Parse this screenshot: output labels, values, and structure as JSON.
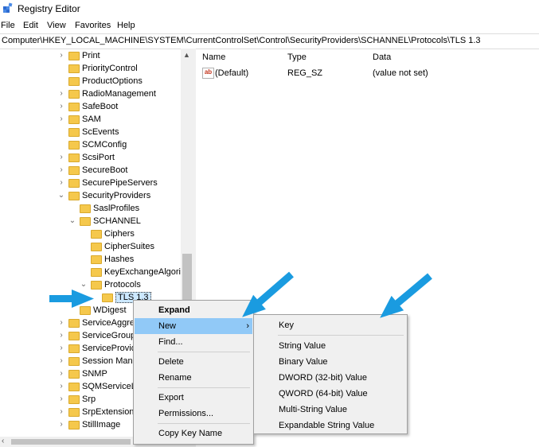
{
  "window": {
    "title": "Registry Editor"
  },
  "menu": [
    "File",
    "Edit",
    "View",
    "Favorites",
    "Help"
  ],
  "address": "Computer\\HKEY_LOCAL_MACHINE\\SYSTEM\\CurrentControlSet\\Control\\SecurityProviders\\SCHANNEL\\Protocols\\TLS 1.3",
  "tree": [
    {
      "label": "Print",
      "depth": 0,
      "exp": "›"
    },
    {
      "label": "PriorityControl",
      "depth": 0,
      "exp": ""
    },
    {
      "label": "ProductOptions",
      "depth": 0,
      "exp": ""
    },
    {
      "label": "RadioManagement",
      "depth": 0,
      "exp": "›"
    },
    {
      "label": "SafeBoot",
      "depth": 0,
      "exp": "›"
    },
    {
      "label": "SAM",
      "depth": 0,
      "exp": "›"
    },
    {
      "label": "ScEvents",
      "depth": 0,
      "exp": ""
    },
    {
      "label": "SCMConfig",
      "depth": 0,
      "exp": ""
    },
    {
      "label": "ScsiPort",
      "depth": 0,
      "exp": "›"
    },
    {
      "label": "SecureBoot",
      "depth": 0,
      "exp": "›"
    },
    {
      "label": "SecurePipeServers",
      "depth": 0,
      "exp": "›"
    },
    {
      "label": "SecurityProviders",
      "depth": 0,
      "exp": "⌄"
    },
    {
      "label": "SaslProfiles",
      "depth": 1,
      "exp": ""
    },
    {
      "label": "SCHANNEL",
      "depth": 1,
      "exp": "⌄"
    },
    {
      "label": "Ciphers",
      "depth": 2,
      "exp": ""
    },
    {
      "label": "CipherSuites",
      "depth": 2,
      "exp": ""
    },
    {
      "label": "Hashes",
      "depth": 2,
      "exp": ""
    },
    {
      "label": "KeyExchangeAlgorit",
      "depth": 2,
      "exp": ""
    },
    {
      "label": "Protocols",
      "depth": 2,
      "exp": "⌄"
    },
    {
      "label": "TLS 1.3",
      "depth": 3,
      "exp": "",
      "selected": true
    },
    {
      "label": "WDigest",
      "depth": 1,
      "exp": ""
    },
    {
      "label": "ServiceAggreg",
      "depth": 0,
      "exp": "›"
    },
    {
      "label": "ServiceGroupC",
      "depth": 0,
      "exp": "›"
    },
    {
      "label": "ServiceProvid",
      "depth": 0,
      "exp": "›"
    },
    {
      "label": "Session Mana",
      "depth": 0,
      "exp": "›"
    },
    {
      "label": "SNMP",
      "depth": 0,
      "exp": "›"
    },
    {
      "label": "SQMServiceLi",
      "depth": 0,
      "exp": "›"
    },
    {
      "label": "Srp",
      "depth": 0,
      "exp": "›"
    },
    {
      "label": "SrpExtensionC",
      "depth": 0,
      "exp": "›"
    },
    {
      "label": "StillImage",
      "depth": 0,
      "exp": "›"
    }
  ],
  "values_pane": {
    "headers": {
      "name": "Name",
      "type": "Type",
      "data": "Data"
    },
    "row": {
      "icon_text": "ab",
      "name": "(Default)",
      "type": "REG_SZ",
      "data": "(value not set)"
    }
  },
  "context_menu": {
    "items": [
      {
        "label": "Expand",
        "bold": true
      },
      {
        "label": "New",
        "highlight": true,
        "submenu": true
      },
      {
        "label": "Find..."
      },
      {
        "sep": true
      },
      {
        "label": "Delete"
      },
      {
        "label": "Rename"
      },
      {
        "sep": true
      },
      {
        "label": "Export"
      },
      {
        "label": "Permissions..."
      },
      {
        "sep": true
      },
      {
        "label": "Copy Key Name"
      }
    ],
    "submenu_arrow": "›"
  },
  "new_submenu": {
    "items": [
      {
        "label": "Key"
      },
      {
        "sep": true
      },
      {
        "label": "String Value"
      },
      {
        "label": "Binary Value"
      },
      {
        "label": "DWORD (32-bit) Value"
      },
      {
        "label": "QWORD (64-bit) Value"
      },
      {
        "label": "Multi-String Value"
      },
      {
        "label": "Expandable String Value"
      }
    ]
  },
  "icons": {
    "app": "registry-editor-icon",
    "folder": "folder-icon",
    "string_value": "string-value-icon",
    "pointer": "blue-pointer-arrow-icon"
  },
  "colors": {
    "selection": "#cce8ff",
    "menu_highlight": "#91c9f7",
    "folder": "#f5c84c",
    "pointer_arrow": "#1a9be0"
  }
}
